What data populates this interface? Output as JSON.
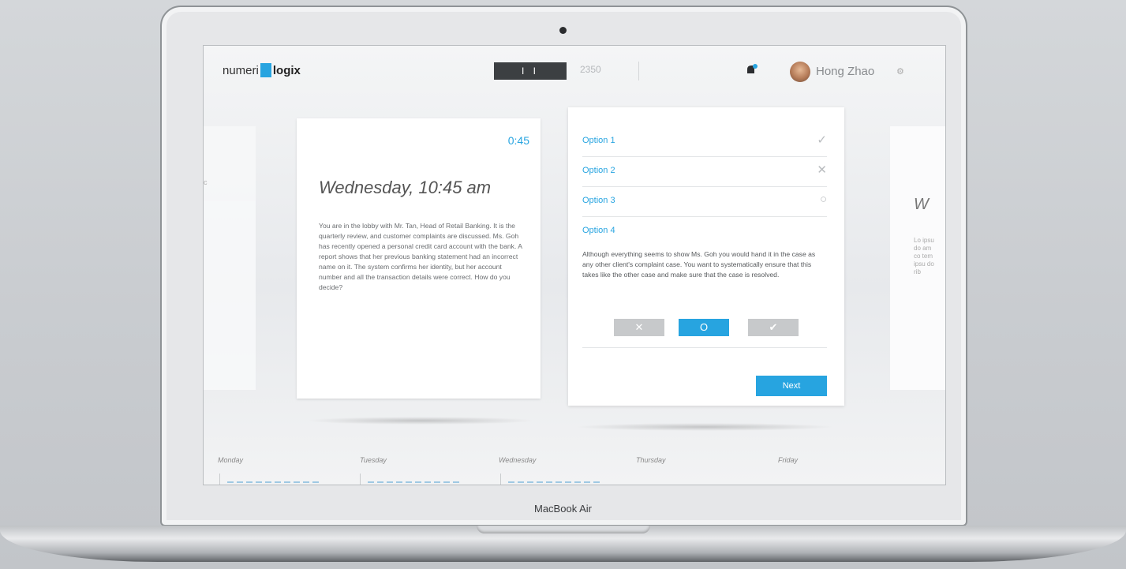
{
  "device": {
    "label": "MacBook Air"
  },
  "header": {
    "brand_prefix": "numeri",
    "brand_suffix": "logix",
    "timer": "I I",
    "points": "2350",
    "user": {
      "name": "Hong Zhao"
    },
    "icons": {
      "notifications": "notification-icon",
      "settings": "gear-icon"
    }
  },
  "scenario": {
    "time": "0:45",
    "title": "Wednesday, 10:45 am",
    "text": "You are in the lobby with Mr. Tan, Head of Retail Banking. It is the quarterly review, and customer complaints are discussed. Ms. Goh has recently opened a personal credit card account with the bank. A report shows that her previous banking statement had an incorrect name on it. The system confirms her identity, but her account number and all the transaction details were correct. How do you decide?"
  },
  "options": {
    "items": [
      {
        "label": "Option 1",
        "state": "check"
      },
      {
        "label": "Option 2",
        "state": "cross"
      },
      {
        "label": "Option 3",
        "state": "circle"
      }
    ],
    "option4": {
      "label": "Option 4",
      "text": "Although everything seems to show Ms. Goh you would hand it in the case as any other client's complaint case. You want to systematically ensure that this takes like the other case and make sure that the case is resolved."
    },
    "buttons": {
      "cross": "✕",
      "circle": "O",
      "check": "✔"
    },
    "next": "Next"
  },
  "week": {
    "days": [
      "Monday",
      "Tuesday",
      "Wednesday",
      "Thursday",
      "Friday"
    ]
  },
  "ghost": {
    "right_title": "W",
    "right_lines": "Lo ipsu do am co tem ipsu do rib"
  },
  "colors": {
    "accent": "#27a4e0",
    "dark": "#3c3f42"
  }
}
